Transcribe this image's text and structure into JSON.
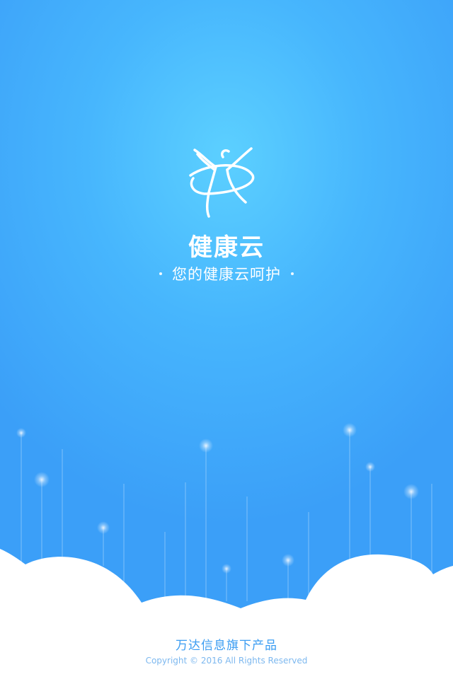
{
  "app": {
    "name": "健康云",
    "tagline": "您的健康云呵护"
  },
  "icons": {
    "logo": "dancing-figure-logo"
  },
  "footer": {
    "company": "万达信息旗下产品",
    "copyright": "Copyright © 2016 All Rights Reserved"
  },
  "colors": {
    "background_light": "#5cd0ff",
    "background_dark": "#3b9ff8",
    "cloud": "#ffffff",
    "footer_text": "#3a9cf2"
  }
}
